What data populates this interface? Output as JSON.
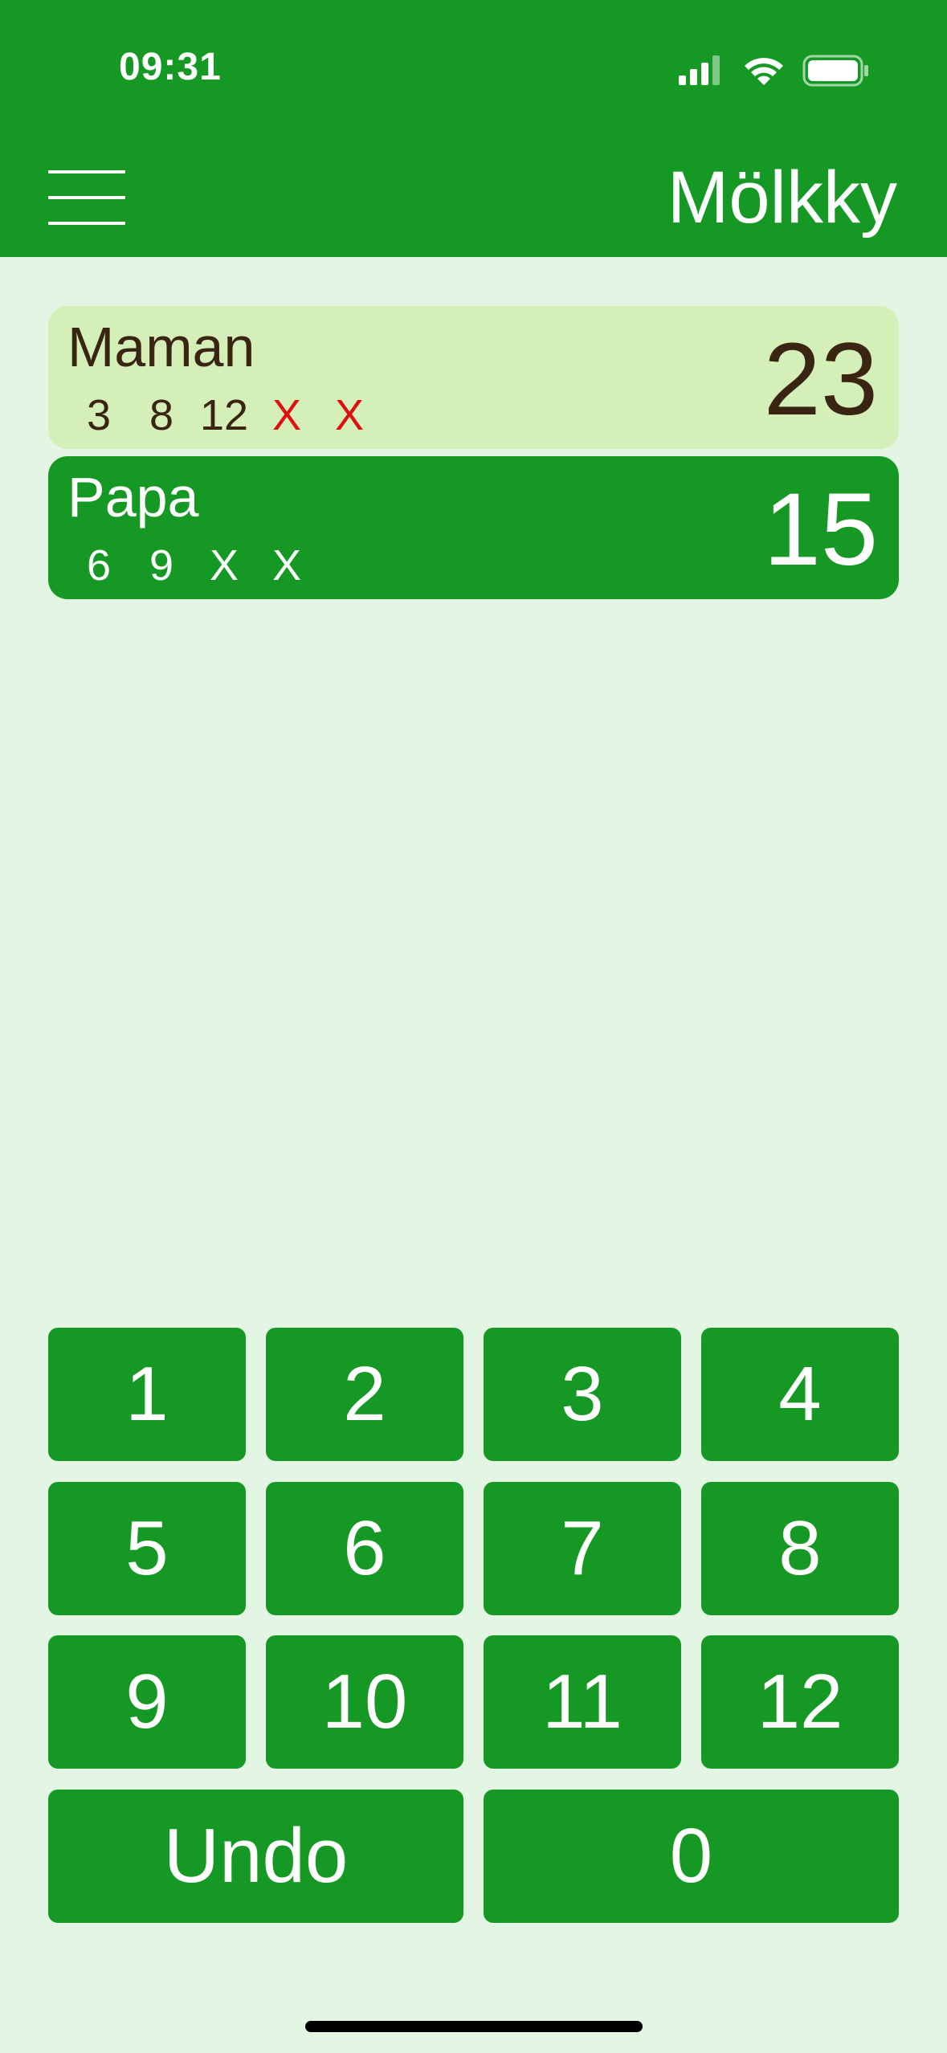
{
  "status_bar": {
    "time": "09:31",
    "icons": [
      "cellular-signal-icon",
      "wifi-icon",
      "battery-icon"
    ]
  },
  "header": {
    "title": "Mölkky",
    "menu_icon": "hamburger-menu-icon"
  },
  "players": [
    {
      "name": "Maman",
      "score": "23",
      "current": true,
      "throws": [
        "3",
        "8",
        "12",
        "X",
        "X"
      ],
      "throw_colors": [
        "#3a2412",
        "#3a2412",
        "#3a2412",
        "#e01010",
        "#e01010"
      ]
    },
    {
      "name": "Papa",
      "score": "15",
      "current": false,
      "throws": [
        "6",
        "9",
        "X",
        "X"
      ]
    }
  ],
  "keypad": {
    "keys": [
      "1",
      "2",
      "3",
      "4",
      "5",
      "6",
      "7",
      "8",
      "9",
      "10",
      "11",
      "12"
    ],
    "undo_label": "Undo",
    "zero_label": "0"
  },
  "colors": {
    "primary_green": "#169924",
    "background": "#e3f5e3",
    "current_player_bg": "#d4f0b8",
    "dark_text": "#3a2412",
    "miss_red": "#e01010"
  }
}
